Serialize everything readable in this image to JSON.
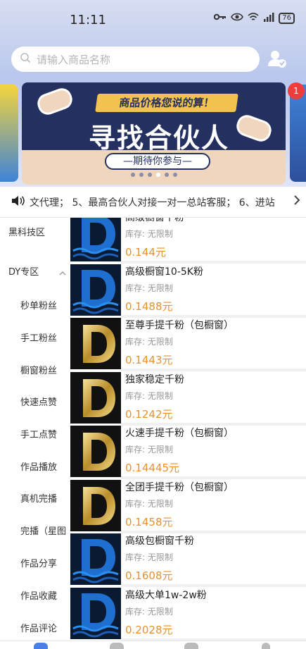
{
  "status_bar": {
    "time": "11:11",
    "battery": "76"
  },
  "search": {
    "placeholder": "请输入商品名称"
  },
  "banner": {
    "slogan": "商品价格您说的算！",
    "title": "寻找合伙人",
    "subtitle": "—期待你参与—",
    "badge_count": "1",
    "dots_total": 6,
    "dots_active_index": 3
  },
  "notice": {
    "text": "文代理；   5、最高合伙人对接一对一总站客服；   6、进站"
  },
  "sidebar": {
    "items": [
      {
        "label": "黑科技区",
        "type": "category"
      },
      {
        "label": "DY专区",
        "type": "category"
      },
      {
        "label": "秒单粉丝",
        "type": "sub"
      },
      {
        "label": "手工粉丝",
        "type": "sub"
      },
      {
        "label": "橱窗粉丝",
        "type": "sub"
      },
      {
        "label": "快速点赞",
        "type": "sub"
      },
      {
        "label": "手工点赞",
        "type": "sub"
      },
      {
        "label": "作品播放",
        "type": "sub"
      },
      {
        "label": "真机完播",
        "type": "sub"
      },
      {
        "label": "完播（星图",
        "type": "sub"
      },
      {
        "label": "作品分享",
        "type": "sub"
      },
      {
        "label": "作品收藏",
        "type": "sub"
      },
      {
        "label": "作品评论",
        "type": "sub"
      }
    ]
  },
  "products": [
    {
      "name": "高级橱窗千粉",
      "stock": "库存: 无限制",
      "price": "0.144元",
      "logo": "blue"
    },
    {
      "name": "高级橱窗10-5K粉",
      "stock": "库存: 无限制",
      "price": "0.1488元",
      "logo": "blue"
    },
    {
      "name": "至尊手提千粉（包橱窗）",
      "stock": "库存: 无限制",
      "price": "0.1443元",
      "logo": "gold"
    },
    {
      "name": "独家稳定千粉",
      "stock": "库存: 无限制",
      "price": "0.1242元",
      "logo": "gold"
    },
    {
      "name": "火速手提千粉（包橱窗）",
      "stock": "库存: 无限制",
      "price": "0.14445元",
      "logo": "gold"
    },
    {
      "name": "全团手提千粉（包橱窗）",
      "stock": "库存: 无限制",
      "price": "0.1458元",
      "logo": "gold"
    },
    {
      "name": "高级包橱窗千粉",
      "stock": "库存: 无限制",
      "price": "0.1608元",
      "logo": "blue"
    },
    {
      "name": "高级大单1w-2w粉",
      "stock": "库存: 无限制",
      "price": "0.2028元",
      "logo": "blue"
    }
  ],
  "colors": {
    "price": "#e8912d",
    "header": "#c9d3ee",
    "badge": "#ef3d3d"
  },
  "icons": {
    "search": "search-icon",
    "user": "user-verified-icon",
    "speaker": "speaker-icon",
    "chevron": "chevron-right-icon"
  }
}
